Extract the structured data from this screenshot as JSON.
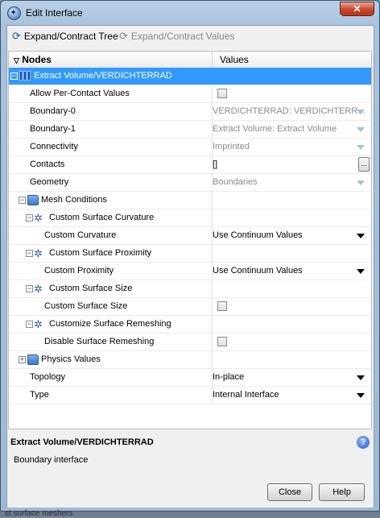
{
  "window": {
    "title": "Edit Interface",
    "close_glyph": "✕"
  },
  "toolbar": {
    "expand_tree": "Expand/Contract Tree",
    "expand_values": "Expand/Contract Values"
  },
  "tree": {
    "header_nodes": "Nodes",
    "header_values": "Values",
    "root": "Extract Volume/VERDICHTERRAD",
    "rows": [
      {
        "label": "Allow Per-Contact Values",
        "kind": "checkbox"
      },
      {
        "label": "Boundary-0",
        "value": "VERDICHTERRAD: VERDICHTERR...",
        "kind": "dropdown-disabled"
      },
      {
        "label": "Boundary-1",
        "value": "Extract Volume: Extract Volume",
        "kind": "dropdown-disabled"
      },
      {
        "label": "Connectivity",
        "value": "Imprinted",
        "kind": "dropdown-disabled"
      },
      {
        "label": "Contacts",
        "value": "[]",
        "kind": "text-button"
      },
      {
        "label": "Geometry",
        "value": "Boundaries",
        "kind": "dropdown-disabled"
      }
    ],
    "mesh_conditions": {
      "label": "Mesh Conditions",
      "curvature_group": "Custom Surface Curvature",
      "curvature_label": "Custom Curvature",
      "curvature_value": "Use Continuum Values",
      "proximity_group": "Custom Surface Proximity",
      "proximity_label": "Custom Proximity",
      "proximity_value": "Use Continuum Values",
      "size_group": "Custom Surface Size",
      "size_label": "Custom Surface Size",
      "remesh_group": "Customize Surface Remeshing",
      "remesh_label": "Disable Surface Remeshing"
    },
    "physics_values": "Physics Values",
    "topology_label": "Topology",
    "topology_value": "In-place",
    "type_label": "Type",
    "type_value": "Internal Interface"
  },
  "info": {
    "title": "Extract Volume/VERDICHTERRAD",
    "description": "Boundary interface",
    "help_glyph": "?"
  },
  "footer": {
    "close": "Close",
    "help": "Help"
  },
  "background_text": "st surface meshers"
}
